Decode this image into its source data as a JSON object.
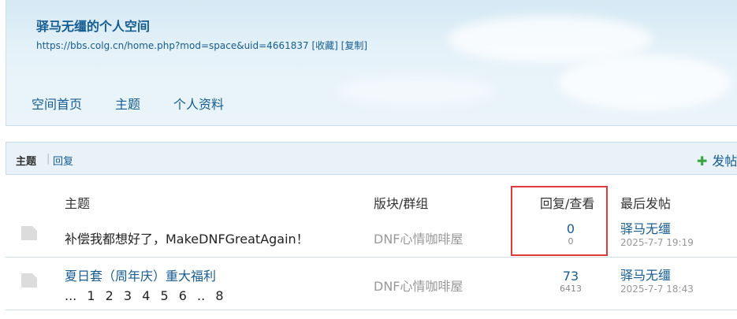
{
  "space": {
    "title": "驿马无缰的个人空间",
    "url": "https://bbs.colg.cn/home.php?mod=space&uid=4661837",
    "favorite_label": "[收藏]",
    "copy_label": "[复制]"
  },
  "nav": [
    "空间首页",
    "主题",
    "个人资料"
  ],
  "tabs": {
    "threads": "主题",
    "separator": "|",
    "replies": "回复",
    "post_label": "发帖"
  },
  "table": {
    "headers": {
      "subject": "主题",
      "forum": "版块/群组",
      "stats": "回复/查看",
      "last": "最后发帖"
    },
    "rows": [
      {
        "subject": "补偿我都想好了，MakeDNFGreatAgain！",
        "forum": "DNF心情咖啡屋",
        "replies": "0",
        "views": "0",
        "last_author": "驿马无缰",
        "last_time": "2025-7-7 19:19"
      },
      {
        "subject": "夏日套（周年庆）重大福利",
        "forum": "DNF心情咖啡屋",
        "replies": "73",
        "views": "6413",
        "last_author": "驿马无缰",
        "last_time": "2025-7-7 18:43",
        "pages": [
          "...",
          "1",
          "2",
          "3",
          "4",
          "5",
          "6",
          "..",
          "8"
        ]
      }
    ]
  },
  "colors": {
    "link": "#155c93",
    "highlight": "#e23a3a"
  }
}
